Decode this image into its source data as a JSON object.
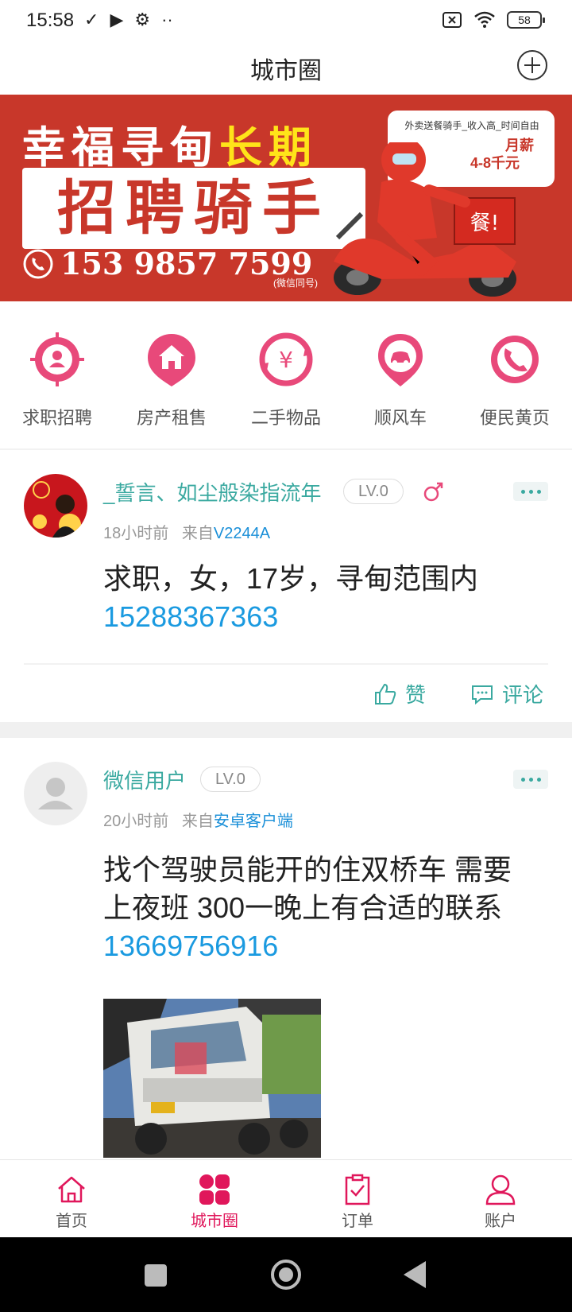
{
  "status_bar": {
    "time": "15:58",
    "left_icons": [
      "check-icon",
      "play-icon",
      "gear-icon",
      "more-dots-icon"
    ],
    "right_icons": [
      "sim-icon",
      "wifi-icon"
    ],
    "battery": "58"
  },
  "header": {
    "title": "城市圈",
    "add_icon": "plus-circle-icon"
  },
  "banner": {
    "line1_a": "幸福寻甸",
    "line1_b": "长期",
    "line2": "招聘骑手",
    "phone": "153 9857 7599",
    "phone_note": "(微信同号)",
    "bubble_text": "外卖送餐骑手_收入高_时间自由",
    "salary_label": "月薪",
    "salary": "4-8千元",
    "box_label": "餐!",
    "colors": {
      "bg": "#c8372a",
      "highlight": "#ffe419"
    }
  },
  "categories": [
    {
      "label": "求职招聘",
      "icon": "person-target-icon"
    },
    {
      "label": "房产租售",
      "icon": "house-icon"
    },
    {
      "label": "二手物品",
      "icon": "yuan-cycle-icon"
    },
    {
      "label": "顺风车",
      "icon": "car-pin-icon"
    },
    {
      "label": "便民黄页",
      "icon": "phone-icon"
    }
  ],
  "posts": [
    {
      "username": "_誓言、如尘般染指流年",
      "level": "LV.0",
      "gender_icon": "male-female-icon",
      "time": "18小时前",
      "from_label": "来自",
      "source": "V2244A",
      "text": "求职，女，17岁，寻甸范围内",
      "phone": "15288367363",
      "like_label": "赞",
      "comment_label": "评论"
    },
    {
      "username": "微信用户",
      "level": "LV.0",
      "time": "20小时前",
      "from_label": "来自",
      "source": "安卓客户端",
      "text": "找个驾驶员能开的住双桥车 需要上夜班 300一晚上有合适的联系 ",
      "phone": "13669756916"
    }
  ],
  "tabs": [
    {
      "label": "首页",
      "icon": "home-icon",
      "active": false
    },
    {
      "label": "城市圈",
      "icon": "grid-icon",
      "active": true
    },
    {
      "label": "订单",
      "icon": "clipboard-check-icon",
      "active": false
    },
    {
      "label": "账户",
      "icon": "user-icon",
      "active": false
    }
  ],
  "colors": {
    "accent": "#e8497a",
    "teal": "#3aa9a0",
    "link": "#1a9ae0",
    "active_tab": "#e0175b"
  }
}
